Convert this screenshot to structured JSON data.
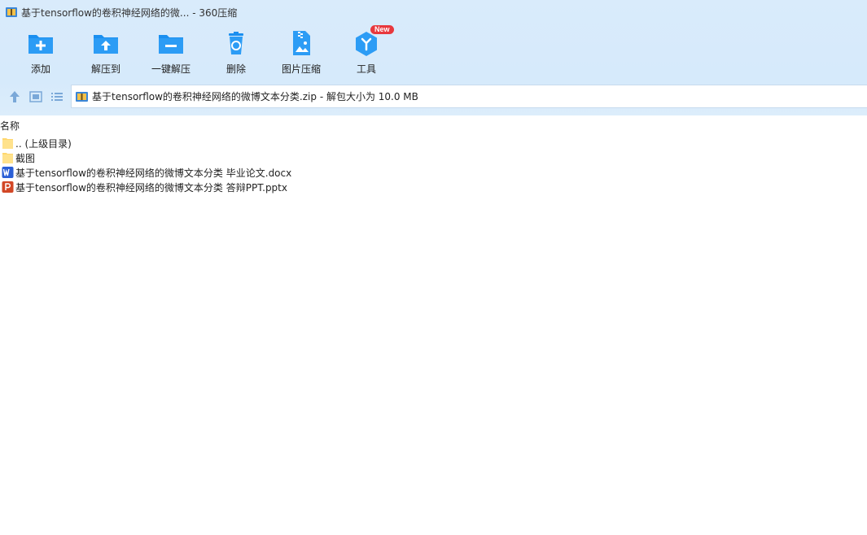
{
  "window": {
    "title": "基于tensorflow的卷积神经网络的微... - 360压缩"
  },
  "toolbar": {
    "items": [
      {
        "label": "添加",
        "icon": "add-folder-icon"
      },
      {
        "label": "解压到",
        "icon": "extract-to-icon"
      },
      {
        "label": "一键解压",
        "icon": "one-click-extract-icon"
      },
      {
        "label": "删除",
        "icon": "delete-icon"
      },
      {
        "label": "图片压缩",
        "icon": "image-compress-icon"
      },
      {
        "label": "工具",
        "icon": "tools-icon",
        "badge": "New"
      }
    ]
  },
  "address": {
    "path": "基于tensorflow的卷积神经网络的微博文本分类.zip - 解包大小为 10.0 MB"
  },
  "list": {
    "column_name": "名称",
    "items": [
      {
        "name": ".. (上级目录)",
        "type": "folder"
      },
      {
        "name": "截图",
        "type": "folder"
      },
      {
        "name": "基于tensorflow的卷积神经网络的微博文本分类 毕业论文.docx",
        "type": "word"
      },
      {
        "name": "基于tensorflow的卷积神经网络的微博文本分类 答辩PPT.pptx",
        "type": "ppt"
      }
    ]
  },
  "colors": {
    "accent": "#1a8ff0",
    "topband": "#d9ebfb",
    "word_blue": "#2b5fd6",
    "ppt_red": "#d24726",
    "folder_yellow": "#ffd76e",
    "badge_red": "#e8383d"
  }
}
